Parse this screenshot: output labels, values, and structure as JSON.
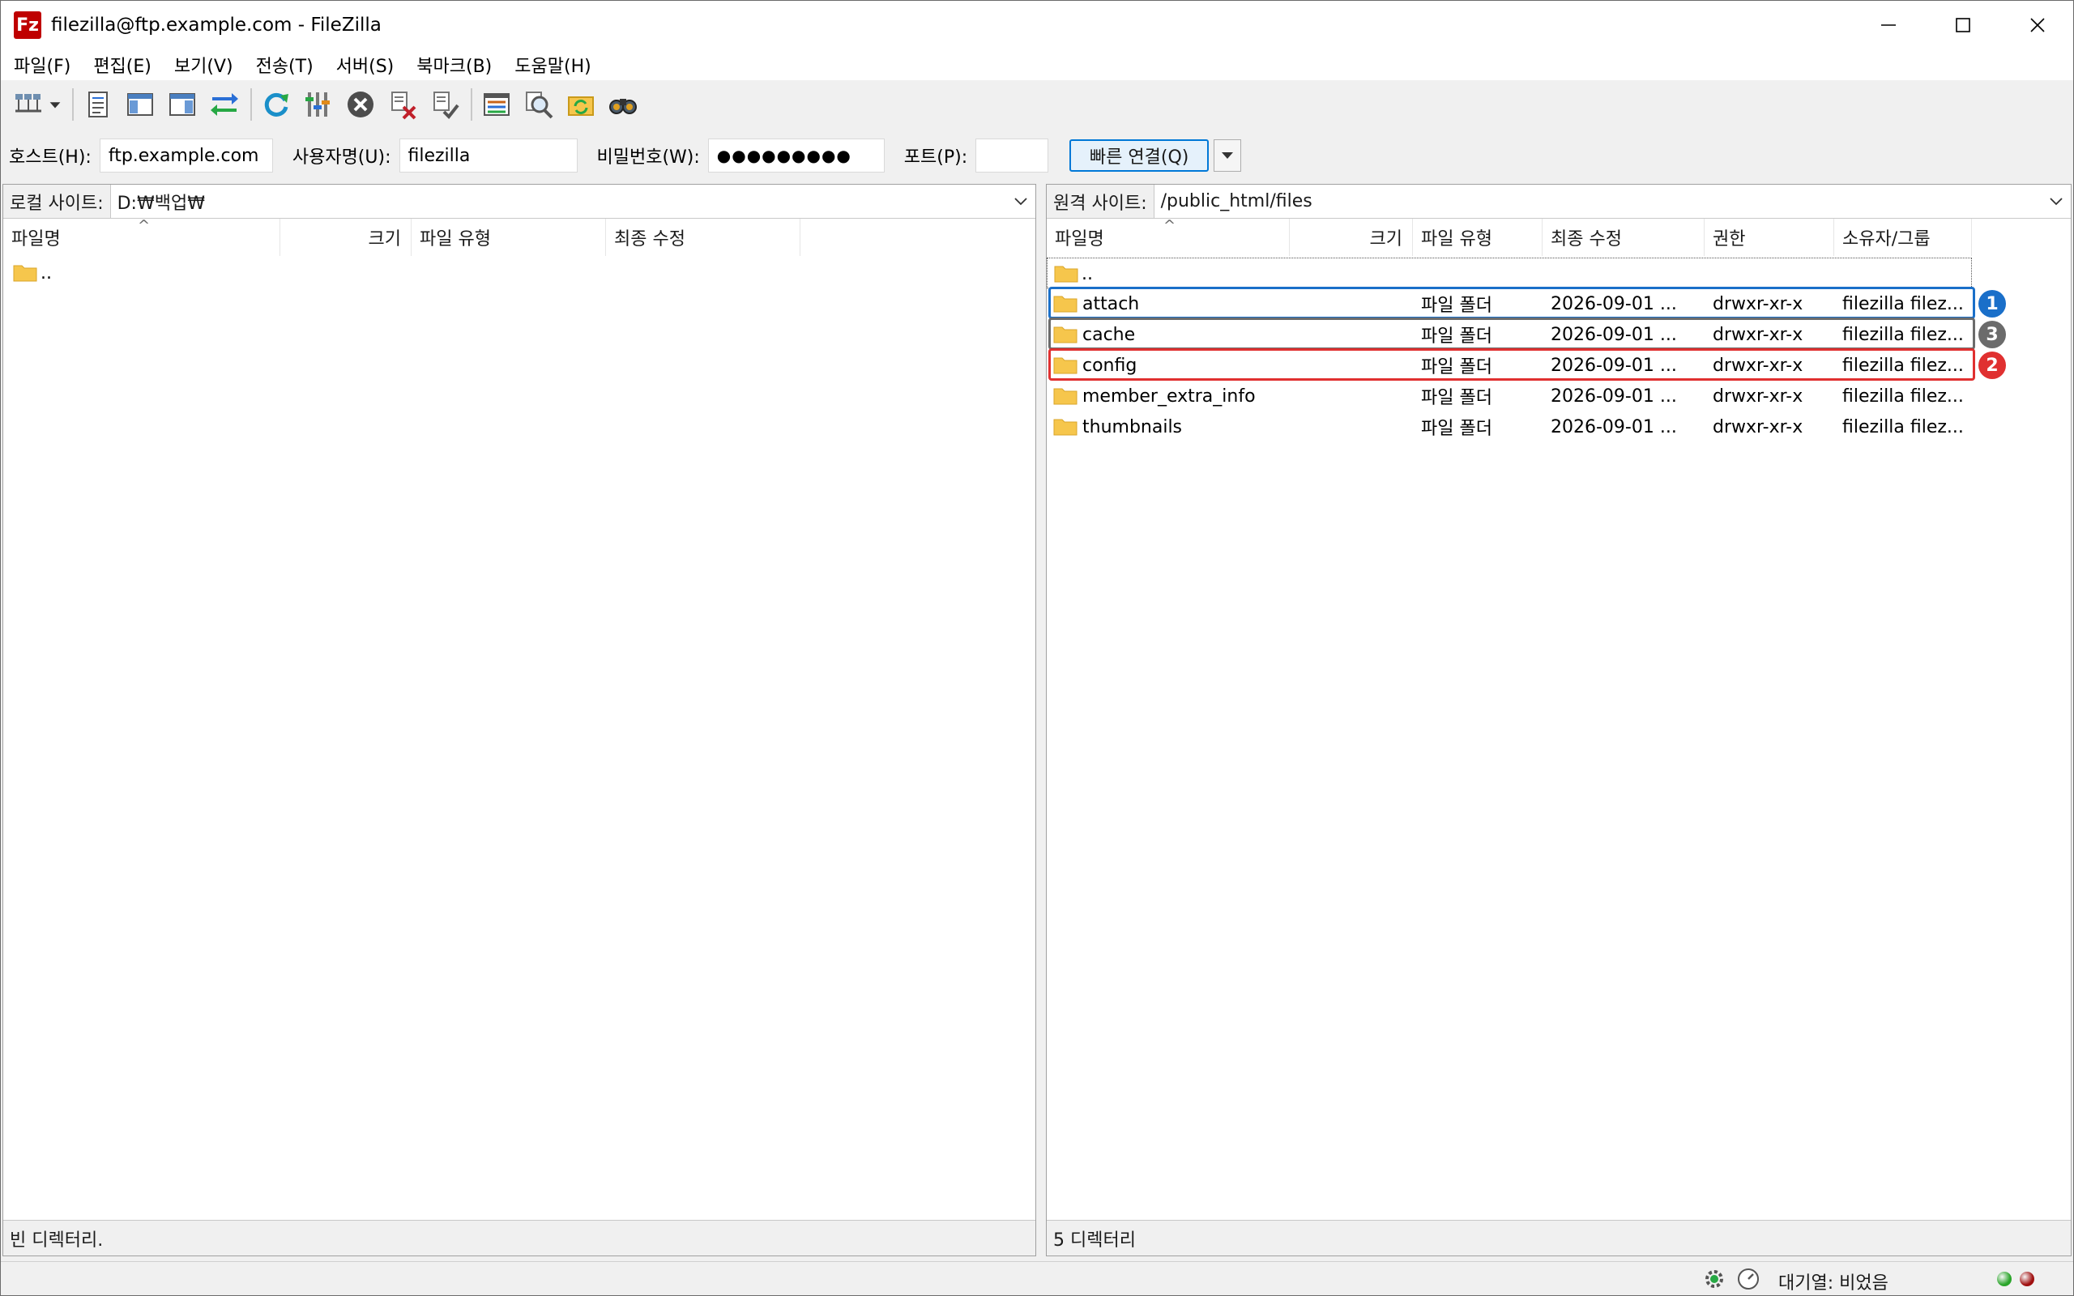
{
  "window": {
    "title": "filezilla@ftp.example.com - FileZilla",
    "app_icon_text": "Fz"
  },
  "menu": [
    "파일(F)",
    "편집(E)",
    "보기(V)",
    "전송(T)",
    "서버(S)",
    "북마크(B)",
    "도움말(H)"
  ],
  "toolbar": {
    "icons": [
      "site-manager-icon",
      "dropdown-arrow-icon",
      "toggle-log-icon",
      "toggle-local-tree-icon",
      "toggle-remote-tree-icon",
      "toggle-queue-icon",
      "refresh-icon",
      "process-queue-icon",
      "cancel-icon",
      "disconnect-icon",
      "reconnect-icon",
      "filter-icon",
      "compare-icon",
      "sync-browse-icon",
      "search-icon"
    ]
  },
  "quickconnect": {
    "host_label": "호스트(H):",
    "host_value": "ftp.example.com",
    "user_label": "사용자명(U):",
    "user_value": "filezilla",
    "pass_label": "비밀번호(W):",
    "pass_value": "●●●●●●●●●",
    "port_label": "포트(P):",
    "port_value": "",
    "connect_label": "빠른 연결(Q)"
  },
  "local": {
    "path_label": "로컬 사이트:",
    "path": "D:₩백업₩",
    "columns": [
      "파일명",
      "크기",
      "파일 유형",
      "최종 수정"
    ],
    "rows": [
      {
        "name": ".."
      }
    ],
    "status": "빈 디렉터리."
  },
  "remote": {
    "path_label": "원격 사이트:",
    "path": "/public_html/files",
    "columns": [
      "파일명",
      "크기",
      "파일 유형",
      "최종 수정",
      "권한",
      "소유자/그룹"
    ],
    "parent": "..",
    "rows": [
      {
        "name": "attach",
        "type": "파일 폴더",
        "modified": "2026-09-01 ...",
        "perm": "drwxr-xr-x",
        "owner": "filezilla filez..."
      },
      {
        "name": "cache",
        "type": "파일 폴더",
        "modified": "2026-09-01 ...",
        "perm": "drwxr-xr-x",
        "owner": "filezilla filez..."
      },
      {
        "name": "config",
        "type": "파일 폴더",
        "modified": "2026-09-01 ...",
        "perm": "drwxr-xr-x",
        "owner": "filezilla filez..."
      },
      {
        "name": "member_extra_info",
        "type": "파일 폴더",
        "modified": "2026-09-01 ...",
        "perm": "drwxr-xr-x",
        "owner": "filezilla filez..."
      },
      {
        "name": "thumbnails",
        "type": "파일 폴더",
        "modified": "2026-09-01 ...",
        "perm": "drwxr-xr-x",
        "owner": "filezilla filez..."
      }
    ],
    "status": "5 디렉터리"
  },
  "annotations": [
    {
      "label": "1",
      "row": "attach",
      "color": "#1a6fc9"
    },
    {
      "label": "3",
      "row": "cache",
      "color": "#6b6b6b"
    },
    {
      "label": "2",
      "row": "config",
      "color": "#e03030"
    }
  ],
  "statusbar": {
    "queue": "대기열: 비었음",
    "led_colors": [
      "#2aa52a",
      "#a01010"
    ]
  },
  "colors": {
    "folder": "#f6c64c",
    "accent": "#0078d7"
  }
}
